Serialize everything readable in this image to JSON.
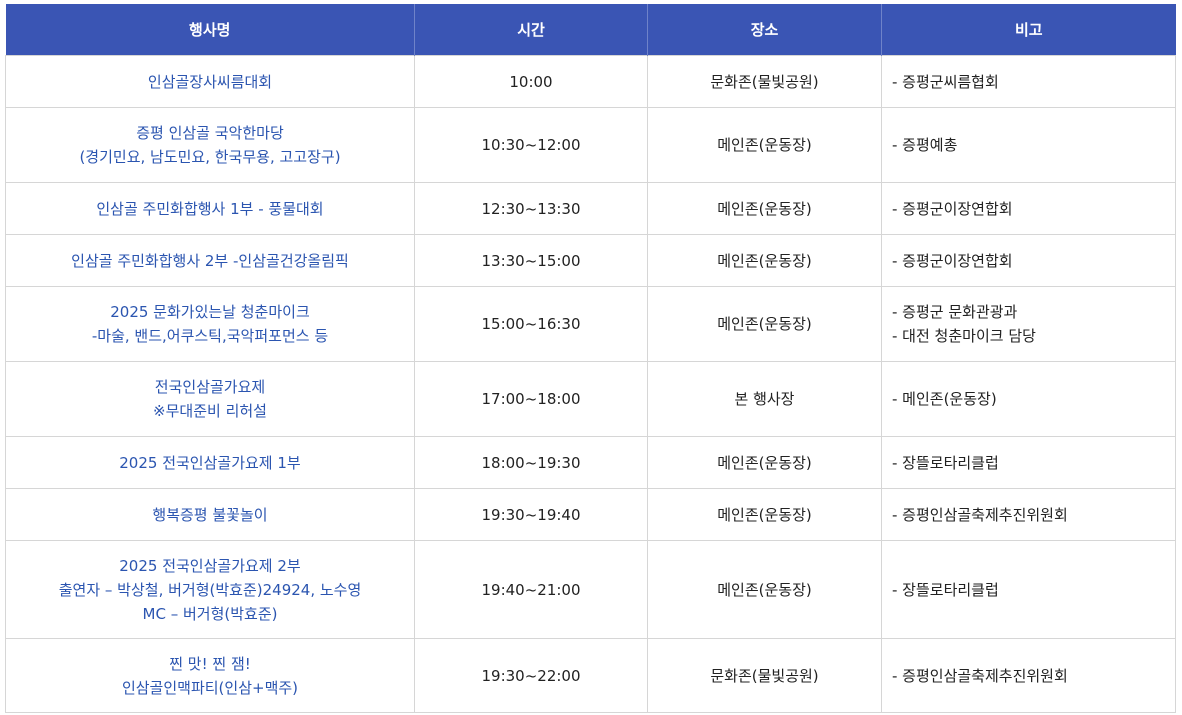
{
  "headers": {
    "event": "행사명",
    "time": "시간",
    "place": "장소",
    "note": "비고"
  },
  "rows": [
    {
      "event": [
        "인삼골장사씨름대회"
      ],
      "time": "10:00",
      "place": "문화존(물빛공원)",
      "note": [
        "- 증평군씨름협회"
      ]
    },
    {
      "event": [
        "증평 인삼골 국악한마당",
        "(경기민요, 남도민요, 한국무용, 고고장구)"
      ],
      "time": "10:30~12:00",
      "place": "메인존(운동장)",
      "note": [
        "- 증평예총"
      ]
    },
    {
      "event": [
        "인삼골 주민화합행사 1부 - 풍물대회"
      ],
      "time": "12:30~13:30",
      "place": "메인존(운동장)",
      "note": [
        "- 증평군이장연합회"
      ]
    },
    {
      "event": [
        "인삼골 주민화합행사 2부 -인삼골건강올림픽"
      ],
      "time": "13:30~15:00",
      "place": "메인존(운동장)",
      "note": [
        "- 증평군이장연합회"
      ]
    },
    {
      "event": [
        "2025 문화가있는날 청춘마이크",
        "-마술, 밴드,어쿠스틱,국악퍼포먼스 등"
      ],
      "time": "15:00~16:30",
      "place": "메인존(운동장)",
      "note": [
        "- 증평군 문화관광과",
        "- 대전 청춘마이크 담당"
      ]
    },
    {
      "event": [
        "전국인삼골가요제",
        "※무대준비 리허설"
      ],
      "time": "17:00~18:00",
      "place": "본 행사장",
      "note": [
        "- 메인존(운동장)"
      ]
    },
    {
      "event": [
        "2025 전국인삼골가요제 1부"
      ],
      "time": "18:00~19:30",
      "place": "메인존(운동장)",
      "note": [
        "- 장뜰로타리클럽"
      ]
    },
    {
      "event": [
        "행복증평 불꽃놀이"
      ],
      "time": "19:30~19:40",
      "place": "메인존(운동장)",
      "note": [
        "- 증평인삼골축제추진위원회"
      ]
    },
    {
      "event": [
        "2025 전국인삼골가요제 2부",
        "출연자 – 박상철, 버거형(박효준)24924, 노수영",
        "MC – 버거형(박효준)"
      ],
      "time": "19:40~21:00",
      "place": "메인존(운동장)",
      "note": [
        "- 장뜰로타리클럽"
      ]
    },
    {
      "event": [
        "찐 맛! 찐 잼!",
        "인삼골인맥파티(인삼+맥주)"
      ],
      "time": "19:30~22:00",
      "place": "문화존(물빛공원)",
      "note": [
        "- 증평인삼골축제추진위원회"
      ]
    }
  ]
}
